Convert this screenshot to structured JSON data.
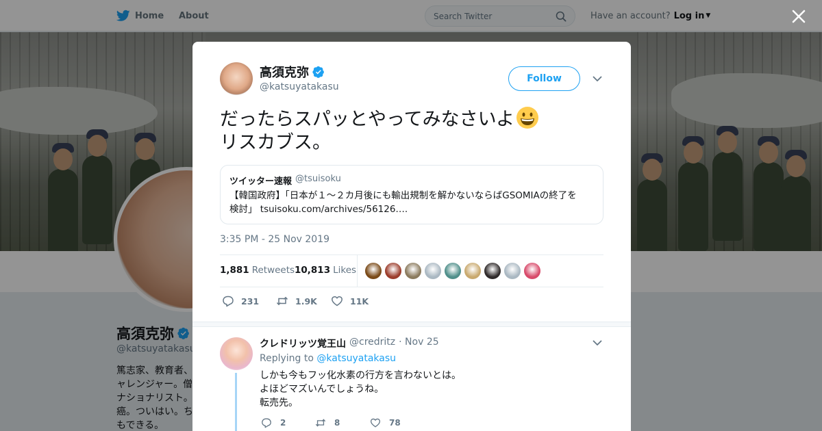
{
  "nav": {
    "home_label": "Home",
    "about_label": "About",
    "search_placeholder": "Search Twitter",
    "have_account": "Have an account?",
    "login_label": "Log in",
    "twitter_blue": "#1da1f2"
  },
  "profile": {
    "name": "高須克弥",
    "handle": "@katsuyatakasu",
    "bio_lines": [
      "篤志家、教育者、",
      "ャレンジャー。僧",
      "ナショナリスト。",
      "癌。ついはい。ち",
      "もできる。"
    ]
  },
  "tweet": {
    "name": "高須克弥",
    "handle": "@katsuyatakasu",
    "follow_label": "Follow",
    "text_line1": "だったらスパッとやってみなさいよ",
    "text_line2": "リスカブス。",
    "quote": {
      "name": "ツイッター速報",
      "handle": "@tsuisoku",
      "text_line1": "【韓国政府】「日本が１～２カ月後にも輸出規制を解かないならばGSOMIAの終了を",
      "text_line2": "検討」 tsuisoku.com/archives/56126…."
    },
    "timestamp": "3:35 PM - 25 Nov 2019",
    "retweet_count": "1,881",
    "retweet_label": "Retweets",
    "like_count": "10,813",
    "like_label": "Likes",
    "actions": {
      "replies": "231",
      "retweets": "1.9K",
      "likes": "11K"
    },
    "liker_colors": [
      "#7a4a18",
      "#9c3d2c",
      "#8b7b5e",
      "#aab8c2",
      "#4f8f8a",
      "#c9a96e",
      "#2f2a2a",
      "#aab8c2",
      "#d84a6a"
    ]
  },
  "reply": {
    "name": "クレドリッツ覚王山",
    "handle": "@credritz",
    "date": "· Nov 25",
    "replying_prefix": "Replying to",
    "replying_to": "@katsuyatakasu",
    "lines": [
      "しかも今もフッ化水素の行方を言わないとは。",
      "よほどマズいんでしょうね。",
      "転売先。"
    ],
    "actions": {
      "replies": "2",
      "retweets": "8",
      "likes": "78"
    }
  }
}
